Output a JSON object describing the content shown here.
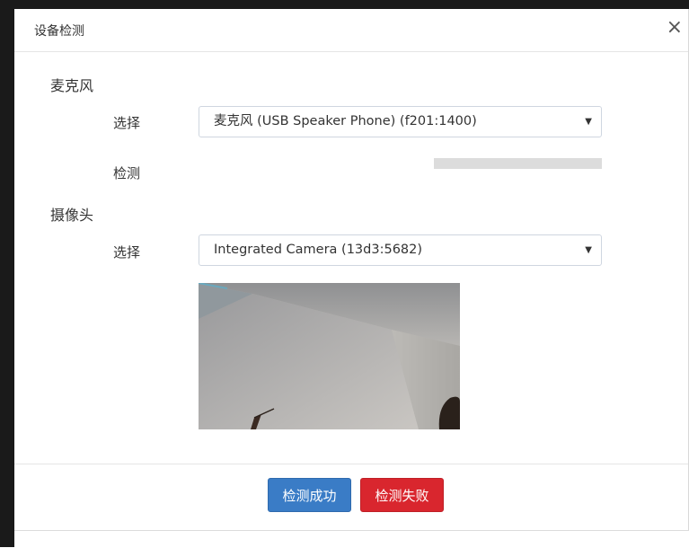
{
  "dialog": {
    "title": "设备检测",
    "close_glyph": "×"
  },
  "microphone": {
    "section_label": "麦克风",
    "select_label": "选择",
    "selected_device": "麦克风 (USB Speaker Phone) (f201:1400)",
    "detect_label": "检测",
    "level_percent": 0
  },
  "camera": {
    "section_label": "摄像头",
    "select_label": "选择",
    "selected_device": "Integrated Camera (13d3:5682)"
  },
  "buttons": {
    "success_label": "检测成功",
    "fail_label": "检测失败"
  },
  "colors": {
    "primary": "#3a7cc6",
    "danger": "#d9262e",
    "meter_track": "#dcdcdc"
  },
  "icons": {
    "dropdown": "caret-down-icon",
    "close": "close-icon"
  }
}
